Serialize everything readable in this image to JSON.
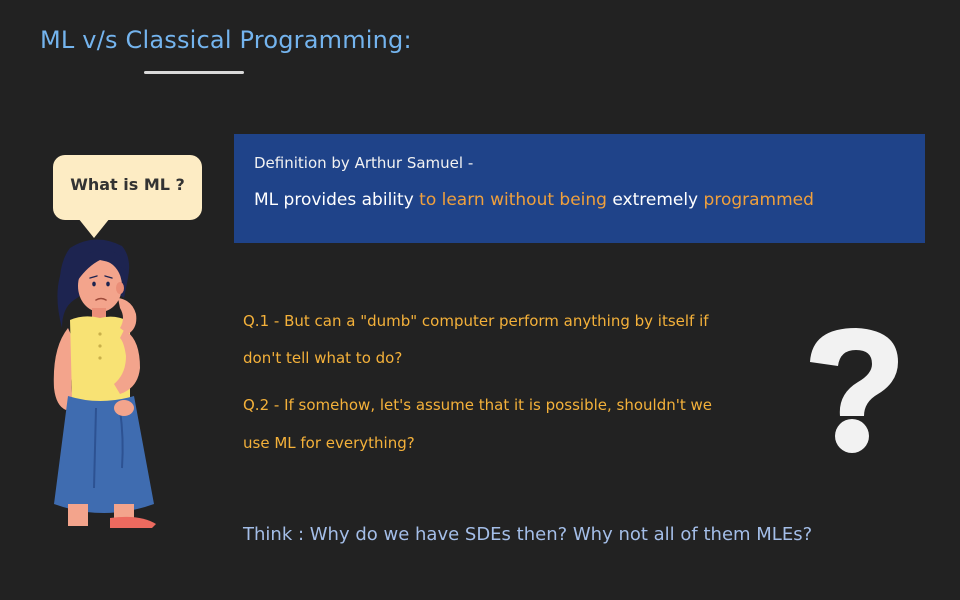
{
  "title": "ML v/s Classical Programming:",
  "bubble": {
    "text": "What is ML ?"
  },
  "definition": {
    "heading": "Definition by Arthur Samuel -",
    "part1": "ML provides ability ",
    "highlight1": "to learn without being",
    "part2": " extremely ",
    "highlight2": "programmed"
  },
  "questions": {
    "q1_line1": "Q.1 - But can a \"dumb\" computer perform anything by itself if",
    "q1_line2": "don't tell what to do?",
    "q2_line1": "Q.2 - If somehow, let's assume that it is possible, shouldn't we",
    "q2_line2": "use ML for everything?"
  },
  "think": "Think : Why do we have SDEs then? Why not all of them MLEs?",
  "colors": {
    "background": "#222222",
    "title": "#74b4ee",
    "definition_box": "#1f4389",
    "highlight": "#f0a03c",
    "question_text": "#f4b13a",
    "think_text": "#a4bee8",
    "bubble": "#fdecc4"
  },
  "icons": {
    "character": "thinking-girl-illustration",
    "question": "question-mark-icon"
  }
}
